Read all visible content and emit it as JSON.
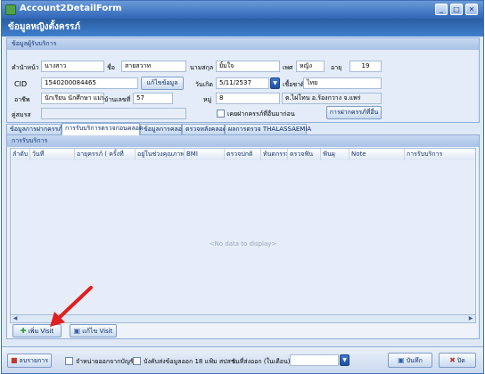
{
  "window": {
    "title": "Account2DetailForm",
    "controls": [
      "_",
      "□",
      "✕"
    ]
  },
  "banner": {
    "title": "ข้อมูลหญิงตั้งครรภ์"
  },
  "client_group": {
    "header": "ข้อมูลผู้รับบริการ",
    "prefix_label": "คำนำหน้า",
    "prefix_value": "นางสาว",
    "name_label": "ชื่อ",
    "name_value": "สายสวาท",
    "surname_label": "นามสกุล",
    "surname_value": "ยิ้มใจ",
    "sex_label": "เพศ",
    "sex_value": "หญิง",
    "age_label": "อายุ",
    "age_value": "19",
    "cid_label": "CID",
    "cid_value": "1540200084465",
    "edit_button": "แก้ไขข้อมูล",
    "dob_label": "วันเกิด",
    "dob_value": "5/11/2537",
    "nationality_label": "เชื้อชาติ",
    "nationality_value": "ไทย",
    "occupation_label": "อาชีพ",
    "occupation_value": "นักเรียน นักศึกษา แม่บ้าน",
    "house_no_label": "บ้านเลขที่",
    "house_no_value": "57",
    "moo_label": "หมู่",
    "moo_value": "8",
    "address_value": "ต.ไผ่โทน อ.ร้องกวาง จ.แพร่",
    "spouse_label": "คู่สมรส",
    "spouse_value": "",
    "prev_pregnancy_label": "เคยฝากครรภ์ที่อื่นมาก่อน",
    "prev_pregnancy_checked": false,
    "anc_button": "การฝากครรภ์ที่อื่น"
  },
  "tabs": [
    {
      "label": "ข้อมูลการฝากครรภ์",
      "active": false
    },
    {
      "label": "การรับบริการตรวจก่อนคลอด",
      "active": true
    },
    {
      "label": "ข้อมูลการคลอด",
      "active": false
    },
    {
      "label": "ตรวจหลังคลอด",
      "active": false
    },
    {
      "label": "ผลการตรวจ THALASSAEMIA",
      "active": false
    }
  ],
  "panel": {
    "header": "การรับบริการ",
    "columns": [
      "ลำดับ",
      "วันที่",
      "อายุครรภ์ ( ครั้งที่",
      "อยู่ในช่วงคุณภาพ",
      "BMI",
      "ตรวจปกติ",
      "ทันตกรรม",
      "ตรวจฟัน",
      "ฟันผุ",
      "Note",
      "การรับบริการ"
    ],
    "empty_text": "<No data to display>",
    "add_visit_button": "เพิ่ม Visit",
    "edit_visit_button": "แก้ไข Visit"
  },
  "bottom": {
    "delete_button": "ลบรายการ",
    "discharge_label": "จำหน่ายออกจากบัญชี",
    "discharge_checked": false,
    "send_form_label": "บังคับส่งข้อมูลออก 18 แฟ้ม สปสช.",
    "send_form_checked": false,
    "send_date_label": "วันที่ส่งออก (ในเดือน)",
    "send_date_value": "",
    "save_button": "บันทึก",
    "close_button": "ปิด"
  },
  "colors": {
    "title_blue": "#2f66b8",
    "banner_blue": "#2a5d9f",
    "border_blue": "#8fadd6",
    "add_green": "#2e9a2e",
    "annotation_red": "#e02020"
  },
  "icons": [
    "app-icon",
    "minimize-icon",
    "maximize-icon",
    "close-icon",
    "calendar-dropdown-icon",
    "dropdown-icon",
    "plus-icon",
    "edit-icon",
    "delete-icon",
    "save-icon",
    "exit-icon",
    "red-arrow-annotation"
  ]
}
